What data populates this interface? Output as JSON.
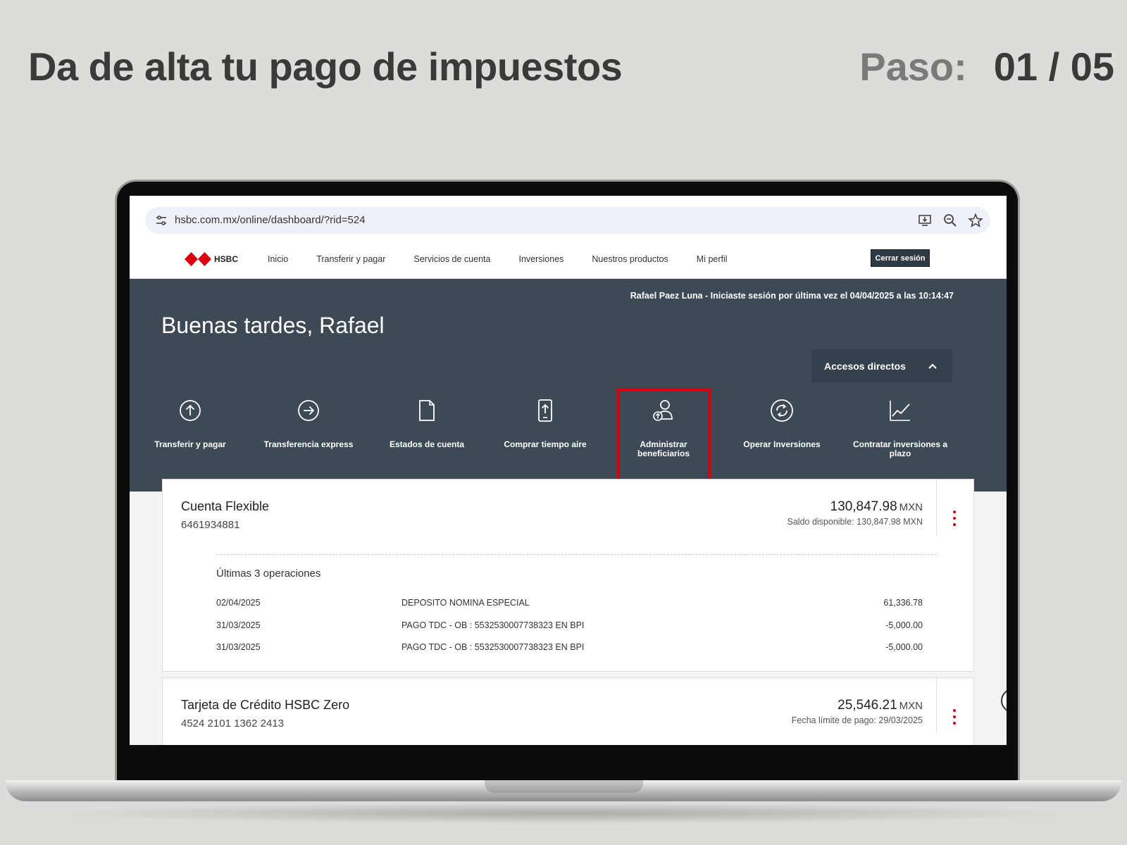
{
  "header": {
    "title": "Da de alta tu pago de impuestos",
    "step_label": "Paso:",
    "step_value": "01 / 05"
  },
  "browser": {
    "url": "hsbc.com.mx/online/dashboard/?rid=524",
    "icons": [
      "tune-icon",
      "install-icon",
      "zoom-icon",
      "star-icon"
    ]
  },
  "nav": {
    "logo": "HSBC",
    "items": [
      "Inicio",
      "Transferir y pagar",
      "Servicios de cuenta",
      "Inversiones",
      "Nuestros productos",
      "Mi perfil"
    ],
    "logout": "Cerrar sesión"
  },
  "hero": {
    "last_login": "Rafael Paez Luna - Iniciaste sesión por última vez el 04/04/2025 a las 10:14:47",
    "greeting": "Buenas tardes, Rafael",
    "quick_toggle": "Accesos directos"
  },
  "quick_actions": [
    {
      "label": "Transferir y pagar",
      "icon": "arrow-up-circle-icon"
    },
    {
      "label": "Transferencia express",
      "icon": "arrow-right-circle-icon"
    },
    {
      "label": "Estados de cuenta",
      "icon": "document-icon"
    },
    {
      "label": "Comprar tiempo aire",
      "icon": "mobile-topup-icon"
    },
    {
      "label": "Administrar beneficiarios",
      "icon": "user-beneficiary-icon",
      "highlighted": true
    },
    {
      "label": "Operar Inversiones",
      "icon": "refresh-circle-icon"
    },
    {
      "label": "Contratar inversiones a plazo",
      "icon": "line-chart-icon"
    }
  ],
  "accounts": [
    {
      "name": "Cuenta Flexible",
      "number": "6461934881",
      "amount": "130,847.98",
      "currency": "MXN",
      "sub": "Saldo disponible: 130,847.98 MXN",
      "ops_title": "Últimas 3 operaciones",
      "ops": [
        {
          "date": "02/04/2025",
          "desc": "DEPOSITO NOMINA ESPECIAL",
          "amount": "61,336.78"
        },
        {
          "date": "31/03/2025",
          "desc": "PAGO TDC - OB : 5532530007738323 EN BPI",
          "amount": "-5,000.00"
        },
        {
          "date": "31/03/2025",
          "desc": "PAGO TDC - OB : 5532530007738323 EN BPI",
          "amount": "-5,000.00"
        }
      ]
    },
    {
      "name": "Tarjeta de Crédito HSBC Zero",
      "number": "4524 2101 1362 2413",
      "amount": "25,546.21",
      "currency": "MXN",
      "sub": "Fecha límite de pago: 29/03/2025"
    }
  ],
  "colors": {
    "brand_red": "#db0011",
    "hero_bg": "#3d4a56",
    "highlight": "#d7000b",
    "page_bg": "#dcdcd8"
  }
}
